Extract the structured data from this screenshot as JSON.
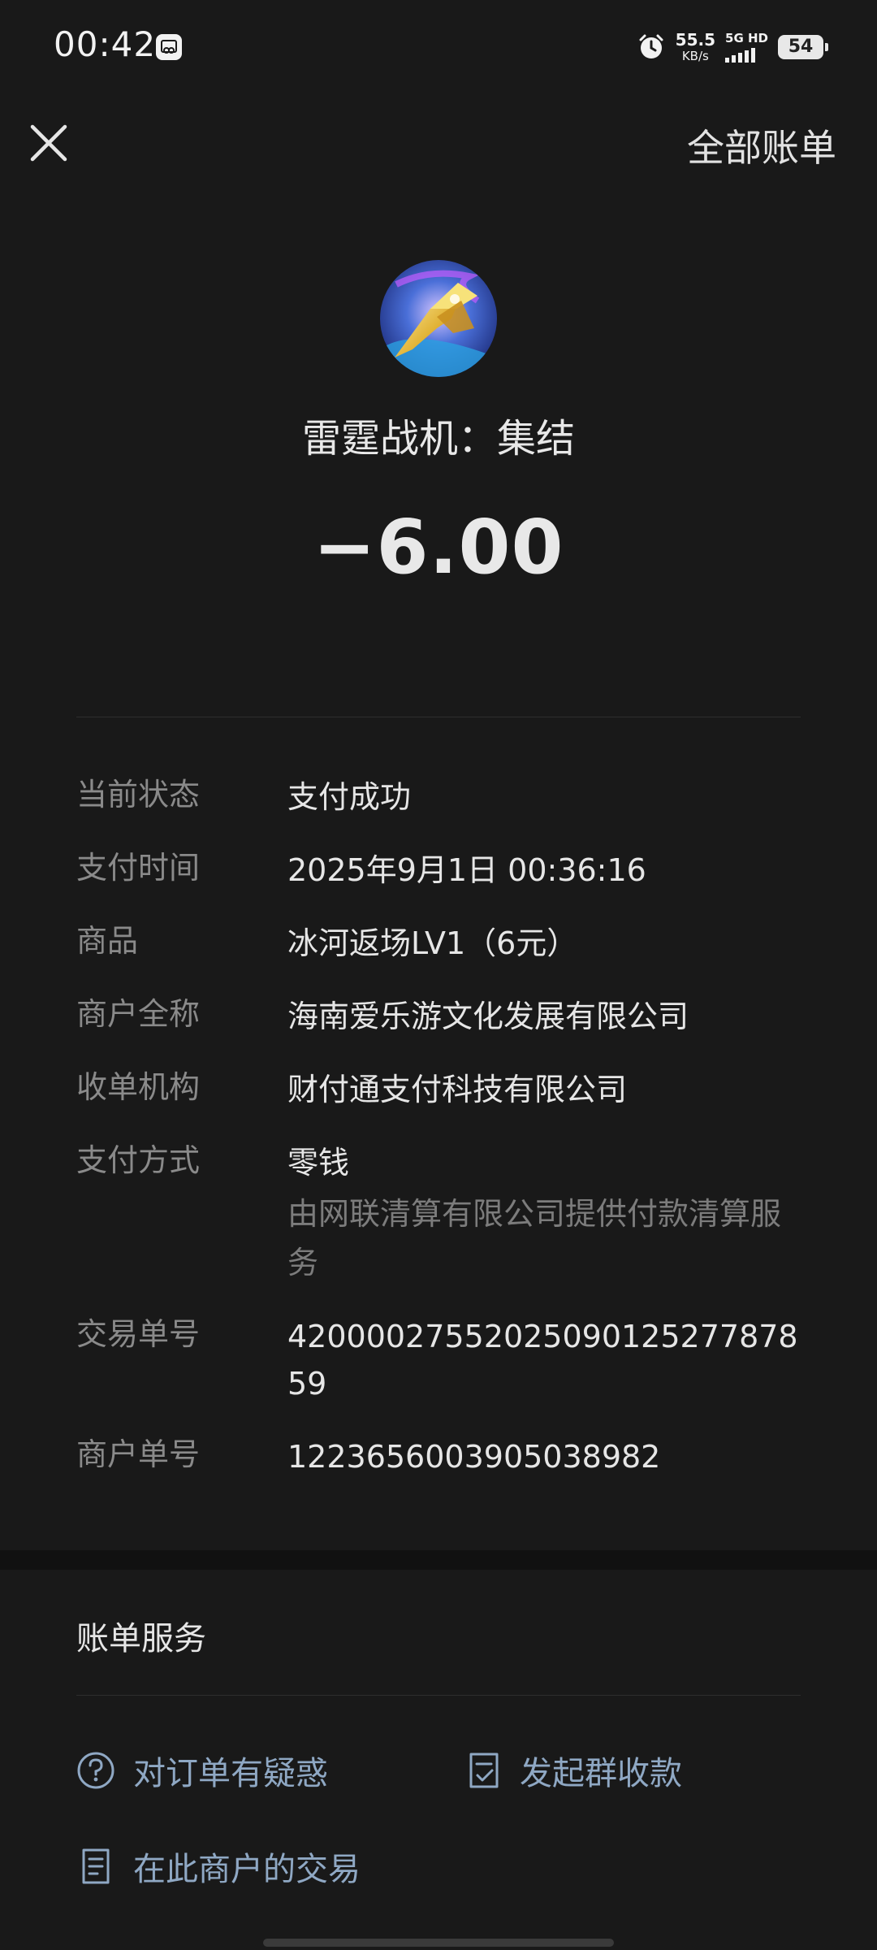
{
  "status_bar": {
    "time": "00:42",
    "net_speed_value": "55.5",
    "net_speed_unit": "KB/s",
    "network_type": "5G HD",
    "battery": "54"
  },
  "header": {
    "close_icon": "close-icon",
    "all_bills_label": "全部账单"
  },
  "merchant": {
    "name": "雷霆战机：集结",
    "amount": "−6.00"
  },
  "details": [
    {
      "key": "当前状态",
      "value": "支付成功"
    },
    {
      "key": "支付时间",
      "value": "2025年9月1日 00:36:16"
    },
    {
      "key": "商品",
      "value": "冰河返场LV1（6元）"
    },
    {
      "key": "商户全称",
      "value": "海南爱乐游文化发展有限公司"
    },
    {
      "key": "收单机构",
      "value": "财付通支付科技有限公司"
    },
    {
      "key": "支付方式",
      "value": "零钱",
      "sub": "由网联清算有限公司提供付款清算服务"
    },
    {
      "key": "交易单号",
      "value": "4200002755202509012527787859"
    },
    {
      "key": "商户单号",
      "value": "1223656003905038982"
    }
  ],
  "bill_service": {
    "title": "账单服务",
    "actions": [
      {
        "label": "对订单有疑惑",
        "icon": "question-circle-icon"
      },
      {
        "label": "发起群收款",
        "icon": "group-collect-icon"
      },
      {
        "label": "在此商户的交易",
        "icon": "document-list-icon"
      }
    ]
  },
  "colors": {
    "background": "#191919",
    "link": "#8fa8c4",
    "label": "#8a8a8a"
  }
}
